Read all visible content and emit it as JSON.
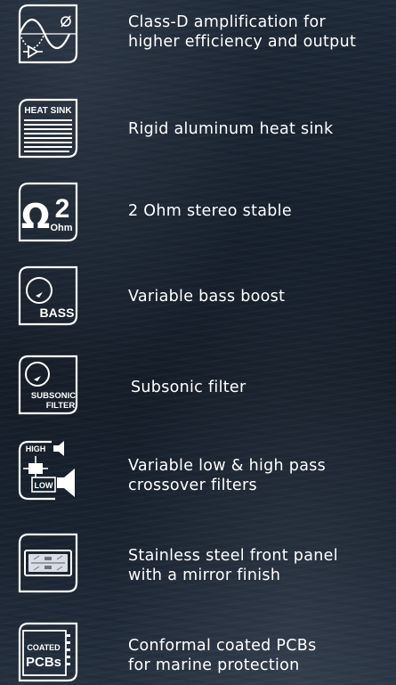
{
  "features": [
    {
      "icon": "class-d-wave-icon",
      "text": "Class-D amplification for\nhigher efficiency and output"
    },
    {
      "icon": "heat-sink-icon",
      "icon_text": "HEAT SINK",
      "text": "Rigid aluminum heat sink"
    },
    {
      "icon": "two-ohm-icon",
      "icon_text": "2",
      "icon_text2": "Ohm",
      "text": "2 Ohm stereo stable"
    },
    {
      "icon": "bass-knob-icon",
      "icon_text": "BASS",
      "text": "Variable bass boost"
    },
    {
      "icon": "subsonic-knob-icon",
      "icon_text": "SUBSONIC",
      "icon_text2": "FILTER",
      "text": "Subsonic filter"
    },
    {
      "icon": "crossover-icon",
      "icon_text": "HIGH",
      "icon_text2": "LOW",
      "text": "Variable low & high pass\ncrossover filters"
    },
    {
      "icon": "front-panel-icon",
      "text": "Stainless steel front panel\nwith a mirror finish"
    },
    {
      "icon": "pcb-icon",
      "icon_text": "COATED",
      "icon_text2": "PCBs",
      "text": "Conformal coated PCBs\nfor marine protection"
    }
  ],
  "colors": {
    "text": "#ffffff",
    "background": "#18222f"
  }
}
